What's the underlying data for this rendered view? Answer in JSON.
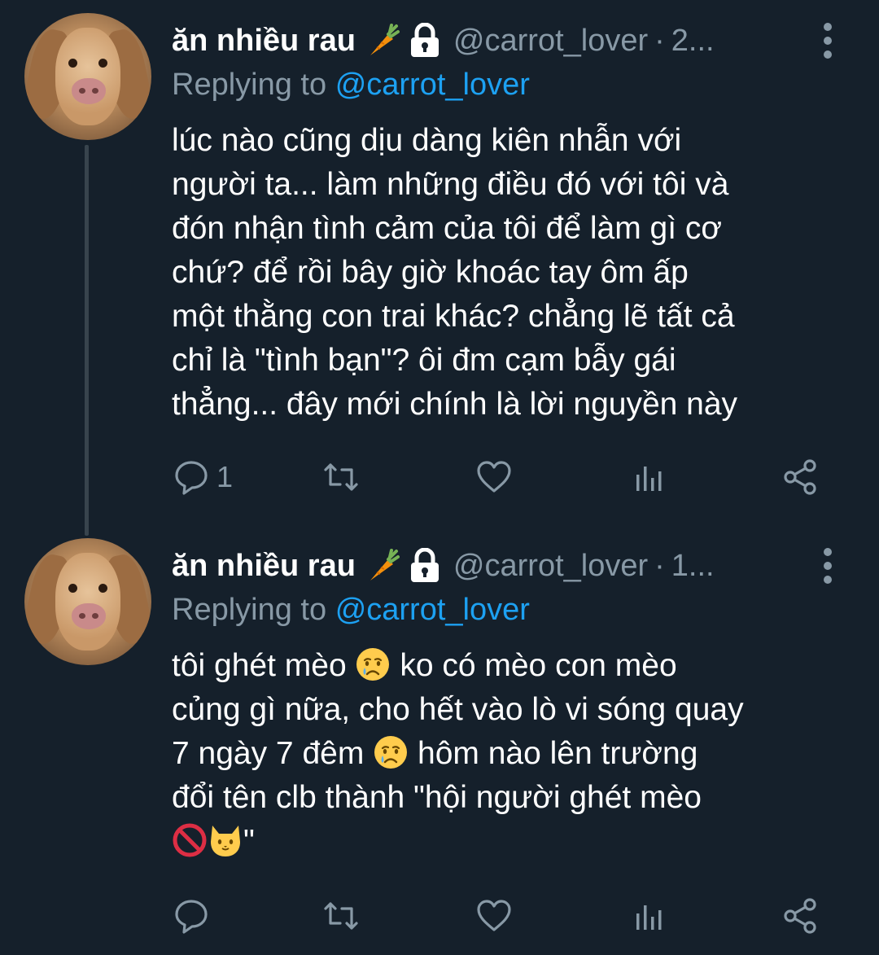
{
  "colors": {
    "background": "#15202b",
    "text": "#ffffff",
    "muted": "#8899a6",
    "accent": "#1da1f2",
    "thread_line": "#38444d"
  },
  "tweets": [
    {
      "display_name": "ăn nhiều rau",
      "name_emoji": "carrot-emoji",
      "protected_icon": "lock-icon",
      "handle": "@carrot_lover",
      "dot": "·",
      "time": "2...",
      "replying_prefix": "Replying to",
      "replying_to": "@carrot_lover",
      "lines": [
        "lúc nào cũng dịu dàng kiên nhẫn với",
        "người ta... làm những điều đó với tôi và",
        "đón nhận tình cảm của tôi để làm gì cơ",
        "chứ? để rồi bây giờ khoác tay ôm ấp",
        "một thằng con trai khác? chẳng lẽ tất cả",
        "chỉ là \"tình bạn\"? ôi đm cạm bẫy gái",
        "thẳng... đây mới chính là lời nguyền này"
      ],
      "reply_count": "1"
    },
    {
      "display_name": "ăn nhiều rau",
      "name_emoji": "carrot-emoji",
      "protected_icon": "lock-icon",
      "handle": "@carrot_lover",
      "dot": "·",
      "time": "1...",
      "replying_prefix": "Replying to",
      "replying_to": "@carrot_lover",
      "line1_a": "tôi ghét mèo",
      "line1_b": "ko có mèo con mèo",
      "line2": "củng gì nữa, cho hết vào lò vi sóng quay",
      "line3_a": "7 ngày 7 đêm",
      "line3_b": "hôm nào lên trường",
      "line4": "đổi tên clb thành \"hội người ghét mèo",
      "line5_end": "\"",
      "emojis": [
        "crying-face-emoji",
        "no-entry-sign-emoji",
        "cat-face-emoji"
      ],
      "reply_count": ""
    }
  ]
}
